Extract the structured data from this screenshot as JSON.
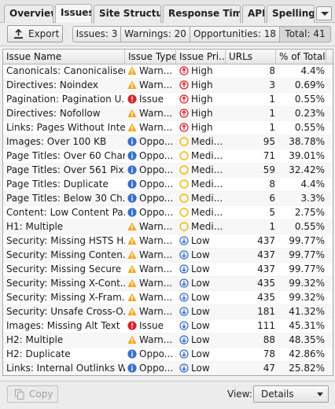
{
  "tabs": [
    {
      "label": "Overview",
      "active": false
    },
    {
      "label": "Issues",
      "active": true
    },
    {
      "label": "Site Structure",
      "active": false
    },
    {
      "label": "Response Times",
      "active": false
    },
    {
      "label": "API",
      "active": false
    },
    {
      "label": "Spelling &",
      "active": false
    }
  ],
  "toolbar": {
    "export_label": "Export",
    "filters": [
      {
        "label": "Issues: 3",
        "selected": false
      },
      {
        "label": "Warnings: 20",
        "selected": false
      },
      {
        "label": "Opportunities: 18",
        "selected": false
      },
      {
        "label": "Total: 41",
        "selected": true
      }
    ]
  },
  "table": {
    "columns": [
      "Issue Name",
      "Issue Type",
      "Issue Pri...",
      "URLs",
      "% of Total"
    ],
    "rows": [
      {
        "name": "Canonicals: Canonicalised",
        "type": "Warn...",
        "type_icon": "warning-icon",
        "priority": "High",
        "priority_icon": "priority-high-icon",
        "urls": "8",
        "pct": "4.4%"
      },
      {
        "name": "Directives: Noindex",
        "type": "Warn...",
        "type_icon": "warning-icon",
        "priority": "High",
        "priority_icon": "priority-high-icon",
        "urls": "3",
        "pct": "0.69%"
      },
      {
        "name": "Pagination: Pagination U...",
        "type": "Issue",
        "type_icon": "issue-icon",
        "priority": "High",
        "priority_icon": "priority-high-icon",
        "urls": "1",
        "pct": "0.55%"
      },
      {
        "name": "Directives: Nofollow",
        "type": "Warn...",
        "type_icon": "warning-icon",
        "priority": "High",
        "priority_icon": "priority-high-icon",
        "urls": "1",
        "pct": "0.23%"
      },
      {
        "name": "Links: Pages Without Inte...",
        "type": "Warn...",
        "type_icon": "warning-icon",
        "priority": "High",
        "priority_icon": "priority-high-icon",
        "urls": "1",
        "pct": "0.55%"
      },
      {
        "name": "Images: Over 100 KB",
        "type": "Oppo...",
        "type_icon": "opportunity-icon",
        "priority": "Medi...",
        "priority_icon": "priority-medium-icon",
        "urls": "95",
        "pct": "38.78%"
      },
      {
        "name": "Page Titles: Over 60 Char...",
        "type": "Oppo...",
        "type_icon": "opportunity-icon",
        "priority": "Medi...",
        "priority_icon": "priority-medium-icon",
        "urls": "71",
        "pct": "39.01%"
      },
      {
        "name": "Page Titles: Over 561 Pix...",
        "type": "Oppo...",
        "type_icon": "opportunity-icon",
        "priority": "Medi...",
        "priority_icon": "priority-medium-icon",
        "urls": "59",
        "pct": "32.42%"
      },
      {
        "name": "Page Titles: Duplicate",
        "type": "Oppo...",
        "type_icon": "opportunity-icon",
        "priority": "Medi...",
        "priority_icon": "priority-medium-icon",
        "urls": "8",
        "pct": "4.4%"
      },
      {
        "name": "Page Titles: Below 30 Ch...",
        "type": "Oppo...",
        "type_icon": "opportunity-icon",
        "priority": "Medi...",
        "priority_icon": "priority-medium-icon",
        "urls": "6",
        "pct": "3.3%"
      },
      {
        "name": "Content: Low Content Pa...",
        "type": "Oppo...",
        "type_icon": "opportunity-icon",
        "priority": "Medi...",
        "priority_icon": "priority-medium-icon",
        "urls": "5",
        "pct": "2.75%"
      },
      {
        "name": "H1: Multiple",
        "type": "Warn...",
        "type_icon": "warning-icon",
        "priority": "Medi...",
        "priority_icon": "priority-medium-icon",
        "urls": "1",
        "pct": "0.55%"
      },
      {
        "name": "Security: Missing HSTS H...",
        "type": "Warn...",
        "type_icon": "warning-icon",
        "priority": "Low",
        "priority_icon": "priority-low-icon",
        "urls": "437",
        "pct": "99.77%"
      },
      {
        "name": "Security: Missing Conten...",
        "type": "Warn...",
        "type_icon": "warning-icon",
        "priority": "Low",
        "priority_icon": "priority-low-icon",
        "urls": "437",
        "pct": "99.77%"
      },
      {
        "name": "Security: Missing Secure ...",
        "type": "Warn...",
        "type_icon": "warning-icon",
        "priority": "Low",
        "priority_icon": "priority-low-icon",
        "urls": "437",
        "pct": "99.77%"
      },
      {
        "name": "Security: Missing X-Cont...",
        "type": "Warn...",
        "type_icon": "warning-icon",
        "priority": "Low",
        "priority_icon": "priority-low-icon",
        "urls": "435",
        "pct": "99.32%"
      },
      {
        "name": "Security: Missing X-Fram...",
        "type": "Warn...",
        "type_icon": "warning-icon",
        "priority": "Low",
        "priority_icon": "priority-low-icon",
        "urls": "435",
        "pct": "99.32%"
      },
      {
        "name": "Security: Unsafe Cross-O...",
        "type": "Warn...",
        "type_icon": "warning-icon",
        "priority": "Low",
        "priority_icon": "priority-low-icon",
        "urls": "181",
        "pct": "41.32%"
      },
      {
        "name": "Images: Missing Alt Text",
        "type": "Issue",
        "type_icon": "issue-icon",
        "priority": "Low",
        "priority_icon": "priority-low-icon",
        "urls": "111",
        "pct": "45.31%"
      },
      {
        "name": "H2: Multiple",
        "type": "Warn...",
        "type_icon": "warning-icon",
        "priority": "Low",
        "priority_icon": "priority-low-icon",
        "urls": "88",
        "pct": "48.35%"
      },
      {
        "name": "H2: Duplicate",
        "type": "Oppo...",
        "type_icon": "opportunity-icon",
        "priority": "Low",
        "priority_icon": "priority-low-icon",
        "urls": "78",
        "pct": "42.86%"
      },
      {
        "name": "Links: Internal Outlinks W...",
        "type": "Oppo...",
        "type_icon": "opportunity-icon",
        "priority": "Low",
        "priority_icon": "priority-low-icon",
        "urls": "47",
        "pct": "25.82%"
      }
    ]
  },
  "bottom": {
    "copy_label": "Copy",
    "view_label": "View:",
    "view_value": "Details"
  },
  "colors": {
    "warning": "#f5a623",
    "issue": "#d9232d",
    "opportunity": "#3b6fc9",
    "priority_high": "#d9232d",
    "priority_medium": "#f2b705",
    "priority_low": "#3b6fc9"
  }
}
